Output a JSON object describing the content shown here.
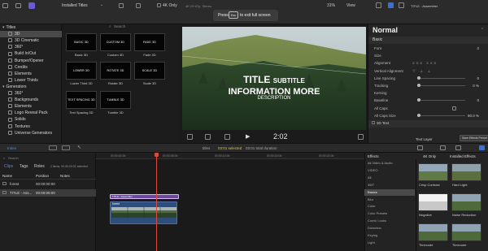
{
  "topbar": {
    "browser_title": "Installed Titles",
    "check_4k": "4K Only",
    "format": "4K 29.97p, Stereo",
    "fullscreen_pre": "Press",
    "fullscreen_key": "Esc",
    "fullscreen_post": "to exit full screen",
    "zoom": "31%",
    "view": "View",
    "inspector_title": "TITLE - Assembler"
  },
  "sidebar": {
    "items": [
      {
        "label": "Titles",
        "level": 0
      },
      {
        "label": "3D",
        "level": 1,
        "selected": true
      },
      {
        "label": "3D Cinematic",
        "level": 1
      },
      {
        "label": "360°",
        "level": 1
      },
      {
        "label": "Build In/Out",
        "level": 1
      },
      {
        "label": "Bumper/Opener",
        "level": 1
      },
      {
        "label": "Credits",
        "level": 1
      },
      {
        "label": "Elements",
        "level": 1
      },
      {
        "label": "Lower Thirds",
        "level": 1
      },
      {
        "label": "Generators",
        "level": 0
      },
      {
        "label": "360°",
        "level": 1
      },
      {
        "label": "Backgrounds",
        "level": 1
      },
      {
        "label": "Elements",
        "level": 1
      },
      {
        "label": "Logo Reveal Pack",
        "level": 1
      },
      {
        "label": "Solids",
        "level": 1
      },
      {
        "label": "Textures",
        "level": 1
      },
      {
        "label": "Universe Generators",
        "level": 1
      }
    ]
  },
  "browser": {
    "search_placeholder": "Search",
    "tiles": [
      {
        "text": "BASIC 3D",
        "label": "Basic 3D"
      },
      {
        "text": "CUSTOM 3D",
        "label": "Custom 3D"
      },
      {
        "text": "FADE 3D",
        "label": "Fade 3D"
      },
      {
        "text": "LOWER 3D",
        "label": "Lower Third 3D"
      },
      {
        "text": "ROTATE 3D",
        "label": "Rotate 3D"
      },
      {
        "text": "SCALE 3D",
        "label": "Scale 3D"
      },
      {
        "text": "TEXT SPACING 3D",
        "label": "Text Spacing 3D"
      },
      {
        "text": "TUMBLE 3D",
        "label": "Tumble 3D"
      }
    ]
  },
  "viewer": {
    "title_line": "TITLE",
    "subtitle_word": "SUBTITLE",
    "info_line": "INFORMATION MORE",
    "description": "DESCRIPTION",
    "timecode": "2:02"
  },
  "inspector": {
    "heading": "Normal",
    "section_basic": "Basic",
    "rows": [
      {
        "label": "Font",
        "value": "2"
      },
      {
        "label": "Size",
        "value": ""
      },
      {
        "label": "Alignment",
        "value": ""
      },
      {
        "label": "Vertical Alignment",
        "value": ""
      },
      {
        "label": "Line Spacing",
        "value": "0"
      },
      {
        "label": "Tracking",
        "value": "0 %"
      },
      {
        "label": "Kerning",
        "value": ""
      },
      {
        "label": "Baseline",
        "value": "0"
      },
      {
        "label": "All Caps",
        "value": ""
      },
      {
        "label": "All Caps Size",
        "value": "80.0 %"
      }
    ],
    "section_3d": "3D Text",
    "text_layer": "Text Layer",
    "save_label": "Save Effects Preset"
  },
  "midbar": {
    "index_label": "Index",
    "titles_label": "titles",
    "selection_info": "03:01 selected",
    "duration_info": "03:01 total duration"
  },
  "index": {
    "tabs": [
      "Clips",
      "Tags",
      "Roles"
    ],
    "items_info": "2 items, 00:00:03:01 selected",
    "search_placeholder": "Search",
    "columns": [
      "Name",
      "Position",
      "Notes"
    ],
    "rows": [
      {
        "name": "forest",
        "position": "00:00:00:00"
      },
      {
        "name": "TITLE - Ass...",
        "position": "00:00:00:00"
      }
    ]
  },
  "timeline": {
    "ruler": [
      "00:00:00:00",
      "00:00:05:00",
      "00:00:10:00",
      "00:00:15:00",
      "00:00:20:00"
    ],
    "title_clip": "TITLE - Assembler",
    "video_clip": "forest"
  },
  "effects": {
    "header_tab1": "Effects",
    "header_tab2": "4K Only",
    "header_tab3": "Installed Effects",
    "categories": [
      "All Video & Audio",
      "VIDEO",
      "All",
      "360°",
      "Basics",
      "Blur",
      "Color",
      "Color Presets",
      "Comic Looks",
      "Distortion",
      "Keying",
      "Light"
    ],
    "selected_category": 4,
    "thumbs": [
      {
        "label": "Crisp Contrast"
      },
      {
        "label": "Hard Light"
      },
      {
        "label": "Negative"
      },
      {
        "label": "Noise Reduction"
      },
      {
        "label": "Timecode"
      },
      {
        "label": "Timecode"
      }
    ]
  }
}
